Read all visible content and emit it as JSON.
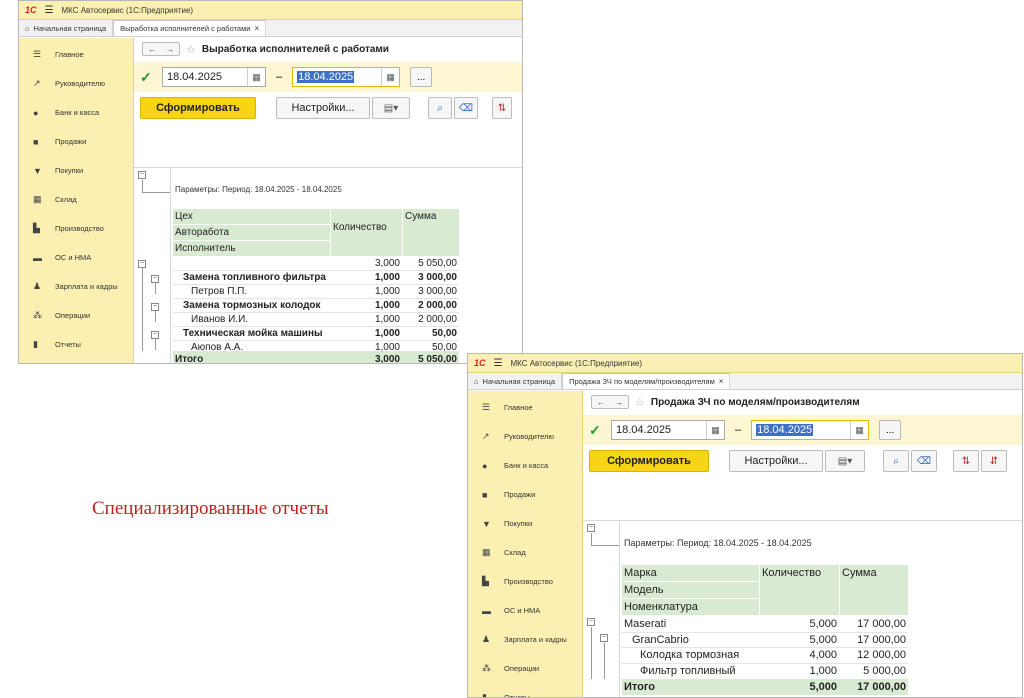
{
  "caption": "Специализированные отчеты",
  "app_title": "МКС Автосервис  (1С:Предприятие)",
  "logo": "1С",
  "nav": [
    "Главное",
    "Руководителю",
    "Банк и касса",
    "Продажи",
    "Покупки",
    "Склад",
    "Производство",
    "ОС и НМА",
    "Зарплата и кадры",
    "Операции",
    "Отчеты"
  ],
  "home_tab": "Начальная страница",
  "generate_label": "Сформировать",
  "settings_label": "Настройки...",
  "more_label": "...",
  "w1": {
    "tab": "Выработка исполнителей с работами",
    "title": "Выработка исполнителей с работами",
    "date_from": "18.04.2025",
    "date_to": "18.04.2025",
    "params": "Параметры:  Период: 18.04.2025 - 18.04.2025",
    "h1": "Цех",
    "h2": "Авторабота",
    "h3": "Исполнитель",
    "hqty": "Количество",
    "hsum": "Сумма",
    "rows": [
      {
        "label": "",
        "qty": "3,000",
        "sum": "5 050,00"
      },
      {
        "label": "Замена топливного фильтра",
        "qty": "1,000",
        "sum": "3 000,00"
      },
      {
        "label": "Петров П.П.",
        "qty": "1,000",
        "sum": "3 000,00"
      },
      {
        "label": "Замена тормозных колодок",
        "qty": "1,000",
        "sum": "2 000,00"
      },
      {
        "label": "Иванов И.И.",
        "qty": "1,000",
        "sum": "2 000,00"
      },
      {
        "label": "Техническая мойка машины",
        "qty": "1,000",
        "sum": "50,00"
      },
      {
        "label": "Аюпов А.А.",
        "qty": "1,000",
        "sum": "50,00"
      }
    ],
    "total": {
      "label": "Итого",
      "qty": "3,000",
      "sum": "5 050,00"
    }
  },
  "w2": {
    "tab": "Продажа ЗЧ по моделям/производителям",
    "title": "Продажа ЗЧ по моделям/производителям",
    "date_from": "18.04.2025",
    "date_to": "18.04.2025",
    "params": "Параметры:  Период: 18.04.2025 - 18.04.2025",
    "h1": "Марка",
    "h2": "Модель",
    "h3": "Номенклатура",
    "hqty": "Количество",
    "hsum": "Сумма",
    "rows": [
      {
        "label": "Maserati",
        "qty": "5,000",
        "sum": "17 000,00"
      },
      {
        "label": "GranCabrio",
        "qty": "5,000",
        "sum": "17 000,00"
      },
      {
        "label": "Колодка тормозная",
        "qty": "4,000",
        "sum": "12 000,00"
      },
      {
        "label": "Фильтр топливный",
        "qty": "1,000",
        "sum": "5 000,00"
      }
    ],
    "total": {
      "label": "Итого",
      "qty": "5,000",
      "sum": "17 000,00"
    }
  }
}
